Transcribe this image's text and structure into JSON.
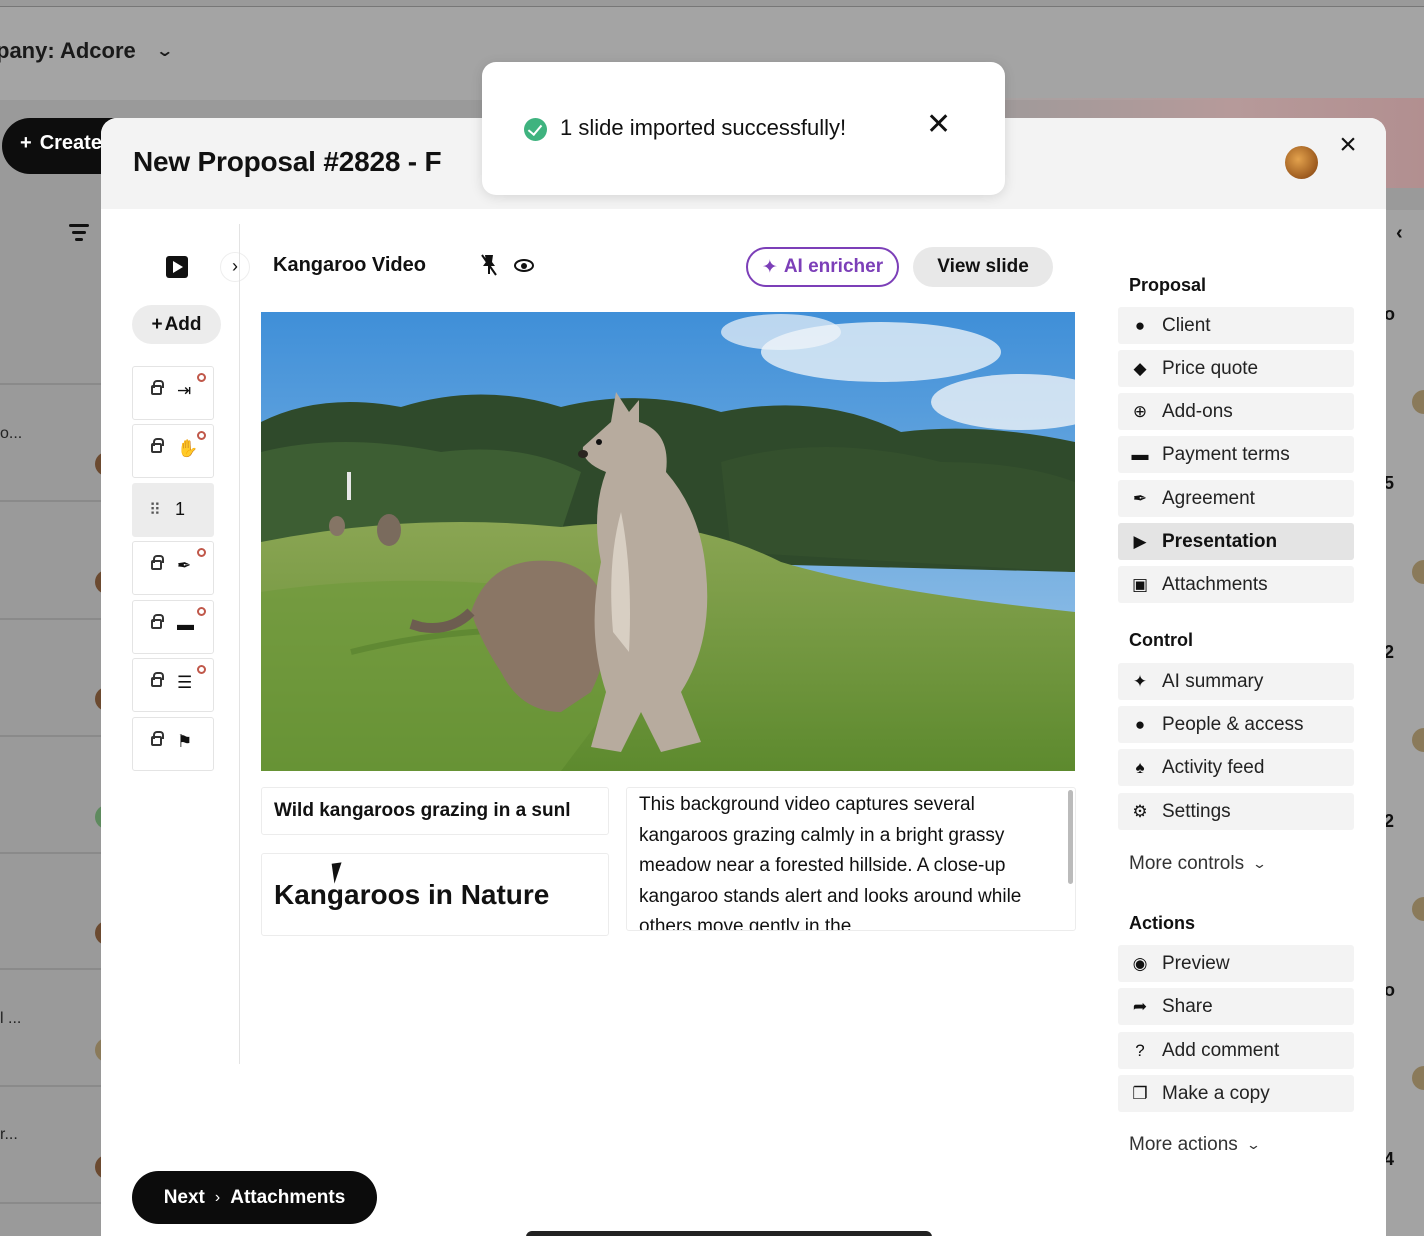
{
  "background": {
    "company_label": "pany: Adcore",
    "create_label": "Create",
    "row_texts": [
      "o...",
      "l ...",
      "r..."
    ],
    "right_numbers": [
      "o",
      "5",
      "2",
      "2",
      "o",
      "4"
    ]
  },
  "toast": {
    "message": "1 slide imported successfully!"
  },
  "modal": {
    "title": "New Proposal #2828   -   F",
    "close_symbol": "×"
  },
  "sidebar": {
    "add_label": "Add",
    "slides": [
      {
        "locked": true,
        "icon": "door-enter-icon",
        "glyph": "⇥",
        "has_dot": true
      },
      {
        "locked": true,
        "icon": "waving-hand-icon",
        "glyph": "✋",
        "has_dot": true
      },
      {
        "locked": false,
        "icon": "drag-grip-icon",
        "number": "1",
        "active": true
      },
      {
        "locked": true,
        "icon": "pen-nib-icon",
        "glyph": "✒",
        "has_dot": true
      },
      {
        "locked": true,
        "icon": "credit-card-icon",
        "glyph": "▬",
        "has_dot": true
      },
      {
        "locked": true,
        "icon": "chat-user-icon",
        "glyph": "☰",
        "has_dot": true
      },
      {
        "locked": true,
        "icon": "flag-icon",
        "glyph": "⚑",
        "has_dot": false
      }
    ]
  },
  "slide": {
    "name": "Kangaroo Video",
    "ai_enricher_label": "AI enricher",
    "view_slide_label": "View slide",
    "subtitle": "Wild kangaroos grazing in a sunl",
    "title": "Kangaroos in Nature",
    "description": "This background video captures several kangaroos grazing calmly in a bright grassy meadow near a forested hillside. A close-up kangaroo stands alert and looks around while others move gently in the"
  },
  "nav": {
    "proposal_heading": "Proposal",
    "proposal_items": [
      {
        "label": "Client",
        "icon": "person-icon",
        "glyph": "●"
      },
      {
        "label": "Price quote",
        "icon": "tag-icon",
        "glyph": "◆"
      },
      {
        "label": "Add-ons",
        "icon": "plus-circle-icon",
        "glyph": "⊕"
      },
      {
        "label": "Payment terms",
        "icon": "card-icon",
        "glyph": "▬"
      },
      {
        "label": "Agreement",
        "icon": "pen-icon",
        "glyph": "✒"
      },
      {
        "label": "Presentation",
        "icon": "play-icon",
        "glyph": "▶",
        "active": true
      },
      {
        "label": "Attachments",
        "icon": "image-icon",
        "glyph": "▣"
      }
    ],
    "control_heading": "Control",
    "control_items": [
      {
        "label": "AI summary",
        "icon": "sparkle-icon",
        "glyph": "✦"
      },
      {
        "label": "People & access",
        "icon": "user-lock-icon",
        "glyph": "●"
      },
      {
        "label": "Activity feed",
        "icon": "bell-icon",
        "glyph": "♠"
      },
      {
        "label": "Settings",
        "icon": "gear-icon",
        "glyph": "⚙"
      }
    ],
    "more_controls_label": "More controls",
    "actions_heading": "Actions",
    "action_items": [
      {
        "label": "Preview",
        "icon": "eye-icon",
        "glyph": "◉"
      },
      {
        "label": "Share",
        "icon": "share-arrow-icon",
        "glyph": "➦"
      },
      {
        "label": "Add comment",
        "icon": "question-icon",
        "glyph": "?"
      },
      {
        "label": "Make a copy",
        "icon": "copy-icon",
        "glyph": "❐"
      }
    ],
    "more_actions_label": "More actions"
  },
  "footer": {
    "next_label": "Next",
    "next_target": "Attachments"
  }
}
